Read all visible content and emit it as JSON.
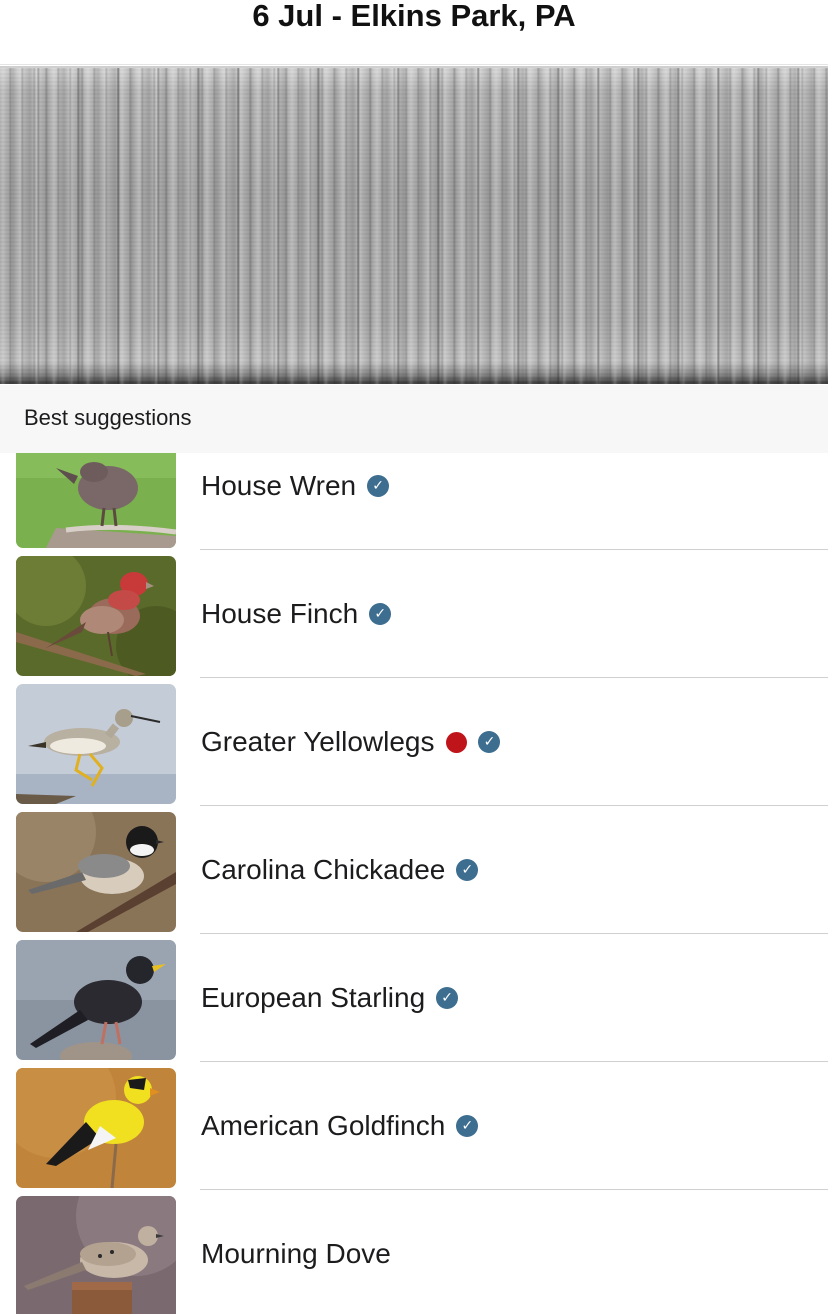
{
  "header": {
    "title": "6 Jul - Elkins Park, PA"
  },
  "section": {
    "label": "Best suggestions"
  },
  "birds": [
    {
      "name": "House Wren",
      "verified": true,
      "red_dot": false
    },
    {
      "name": "House Finch",
      "verified": true,
      "red_dot": false
    },
    {
      "name": "Greater Yellowlegs",
      "verified": true,
      "red_dot": true
    },
    {
      "name": "Carolina Chickadee",
      "verified": true,
      "red_dot": false
    },
    {
      "name": "European Starling",
      "verified": true,
      "red_dot": false
    },
    {
      "name": "American Goldfinch",
      "verified": true,
      "red_dot": false
    },
    {
      "name": "Mourning Dove",
      "verified": false,
      "red_dot": false
    }
  ],
  "icons": {
    "verified": "check-badge-icon",
    "status": "red-dot-icon"
  },
  "colors": {
    "verified_badge": "#3d6d8f",
    "status_dot": "#c0141b"
  }
}
